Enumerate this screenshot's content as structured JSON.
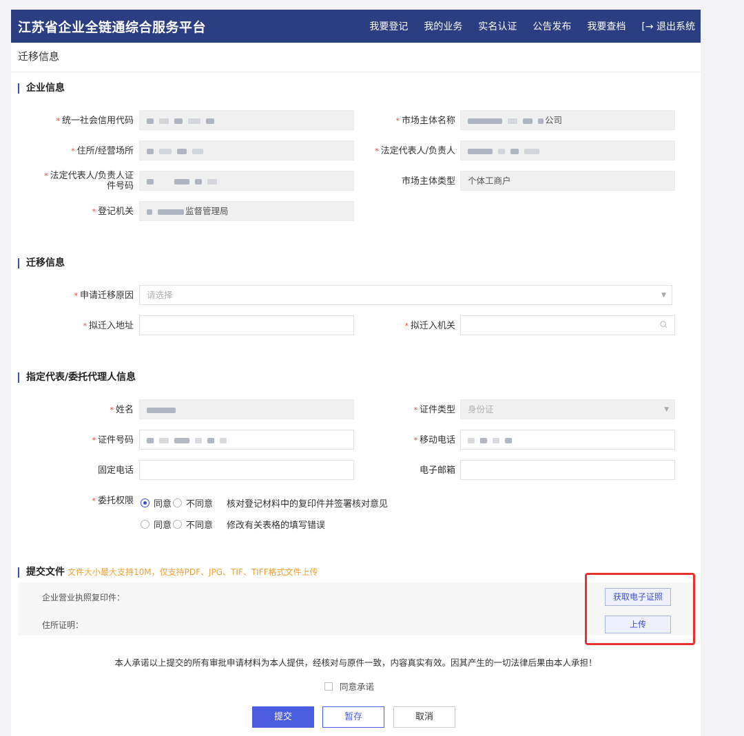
{
  "header": {
    "brand": "江苏省企业全链通综合服务平台",
    "nav": [
      "我要登记",
      "我的业务",
      "实名认证",
      "公告发布",
      "我要查档",
      "[→ 退出系统"
    ]
  },
  "page_title": "迁移信息",
  "sections": {
    "enterprise": "企业信息",
    "migration": "迁移信息",
    "agent": "指定代表/委托代理人信息",
    "files": "提交文件",
    "files_hint": "文件大小最大支持10M，仅支持PDF、JPG、TIF、TIFF格式文件上传"
  },
  "enterprise": {
    "credit_code_label": "统一社会信用代码",
    "name_label": "市场主体名称",
    "name_suffix": "公司",
    "address_label": "住所/经营场所",
    "legal_rep_label": "法定代表人/负责人",
    "legal_id_label_1": "法定代表人/负责人证",
    "legal_id_label_2": "件号码",
    "entity_type_label": "市场主体类型",
    "entity_type_value": "个体工商户",
    "authority_label": "登记机关",
    "authority_suffix": "监督管理局"
  },
  "migration": {
    "reason_label": "申请迁移原因",
    "reason_placeholder": "请选择",
    "new_address_label": "拟迁入地址",
    "new_authority_label": "拟迁入机关"
  },
  "agent": {
    "name_label": "姓名",
    "id_type_label": "证件类型",
    "id_type_value": "身份证",
    "id_no_label": "证件号码",
    "mobile_label": "移动电话",
    "phone_label": "固定电话",
    "email_label": "电子邮箱",
    "authority_label": "委托权限",
    "agree": "同意",
    "disagree": "不同意",
    "perm1_desc": "核对登记材料中的复印件并签署核对意见",
    "perm2_desc": "修改有关表格的填写错误"
  },
  "files": {
    "license_label": "企业营业执照复印件：",
    "residence_label": "住所证明：",
    "get_cert_button": "获取电子证照",
    "upload_button": "上传"
  },
  "pledge": "本人承诺以上提交的所有审批申请材料为本人提供，经核对与原件一致，内容真实有效。因其产生的一切法律后果由本人承担！",
  "agree_pledge": "同意承诺",
  "buttons": {
    "submit": "提交",
    "save": "暂存",
    "cancel": "取消"
  }
}
